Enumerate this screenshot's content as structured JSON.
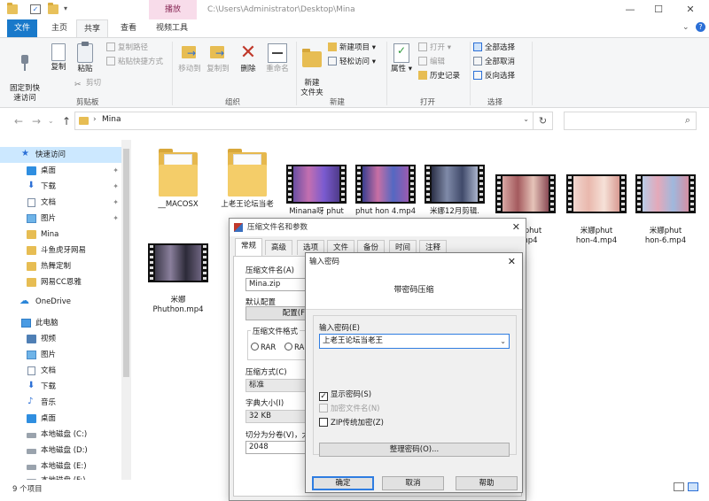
{
  "window": {
    "context_tab": "播放",
    "title_path": "C:\\Users\\Administrator\\Desktop\\Mina",
    "minimize": "—",
    "maximize": "☐",
    "close": "✕"
  },
  "ribbon_tabs": {
    "file": "文件",
    "home": "主页",
    "share": "共享",
    "view": "查看",
    "video_tools": "视频工具"
  },
  "ribbon": {
    "pin_quick": "固定到快\n速访问",
    "copy": "复制",
    "paste": "粘贴",
    "copy_path": "复制路径",
    "paste_shortcut": "粘贴快捷方式",
    "cut": "剪切",
    "group_clipboard": "剪贴板",
    "move_to": "移动到",
    "copy_to": "复制到",
    "delete": "删除",
    "rename": "重命名",
    "group_organize": "组织",
    "new_item": "新建项目",
    "easy_access": "轻松访问",
    "new_folder": "新建\n文件夹",
    "group_new": "新建",
    "properties": "属性",
    "open": "打开",
    "edit": "编辑",
    "history": "历史记录",
    "group_open": "打开",
    "select_all": "全部选择",
    "select_none": "全部取消",
    "invert_selection": "反向选择",
    "group_select": "选择"
  },
  "address": {
    "path": "Mina",
    "back": "←",
    "forward": "→",
    "up": "↑",
    "refresh": "↻",
    "search_icon": "⌕"
  },
  "nav": {
    "items": [
      {
        "label": "快速访问"
      },
      {
        "label": "桌面"
      },
      {
        "label": "下载"
      },
      {
        "label": "文档"
      },
      {
        "label": "图片"
      },
      {
        "label": "Mina"
      },
      {
        "label": "斗鱼虎牙网易"
      },
      {
        "label": "热舞定制"
      },
      {
        "label": "网易CC恩雅"
      },
      {
        "label": "OneDrive"
      },
      {
        "label": "此电脑"
      },
      {
        "label": "视频"
      },
      {
        "label": "图片"
      },
      {
        "label": "文档"
      },
      {
        "label": "下载"
      },
      {
        "label": "音乐"
      },
      {
        "label": "桌面"
      },
      {
        "label": "本地磁盘 (C:)"
      },
      {
        "label": "本地磁盘 (D:)"
      },
      {
        "label": "本地磁盘 (E:)"
      },
      {
        "label": "本地磁盘 (F:)"
      }
    ],
    "pin_glyph": "📌"
  },
  "files": [
    {
      "name": "__MACOSX",
      "type": "folder"
    },
    {
      "name": "上老王论坛当老",
      "type": "folder"
    },
    {
      "name": "Minana呀 phut",
      "type": "video"
    },
    {
      "name": "phut hon 4.mp4",
      "type": "video"
    },
    {
      "name": "米娜12月剪辑.",
      "type": "video"
    },
    {
      "name": "米娜phut\n3.mp4",
      "type": "video"
    },
    {
      "name": "米娜phut\nhon-4.mp4",
      "type": "video"
    },
    {
      "name": "米娜phut\nhon-6.mp4",
      "type": "video"
    },
    {
      "name": "米娜\nPhuthon.mp4",
      "type": "video"
    }
  ],
  "status": {
    "count": "9 个项目"
  },
  "archive_dialog": {
    "title": "压缩文件名和参数",
    "tabs": [
      "常规",
      "高级",
      "选项",
      "文件",
      "备份",
      "时间",
      "注释"
    ],
    "archive_name_label": "压缩文件名(A)",
    "archive_name_value": "Mina.zip",
    "default_profile_label": "默认配置",
    "profiles_button": "配置(F",
    "format_label": "压缩文件格式",
    "format_rar": "RAR",
    "format_rar4": "RAR",
    "method_label": "压缩方式(C)",
    "method_value": "标准",
    "dict_label": "字典大小(I)",
    "dict_value": "32 KB",
    "split_label": "切分为分卷(V)，大",
    "split_value": "2048",
    "close": "✕"
  },
  "password_dialog": {
    "title": "输入密码",
    "header": "带密码压缩",
    "enter_label": "输入密码(E)",
    "password_value": "上老王论坛当老王",
    "show_password": "显示密码(S)",
    "show_password_checked": "✓",
    "encrypt_names": "加密文件名(N)",
    "zip_legacy": "ZIP传统加密(Z)",
    "organize_button": "整理密码(O)...",
    "ok": "确定",
    "cancel": "取消",
    "help": "帮助",
    "close": "✕"
  }
}
